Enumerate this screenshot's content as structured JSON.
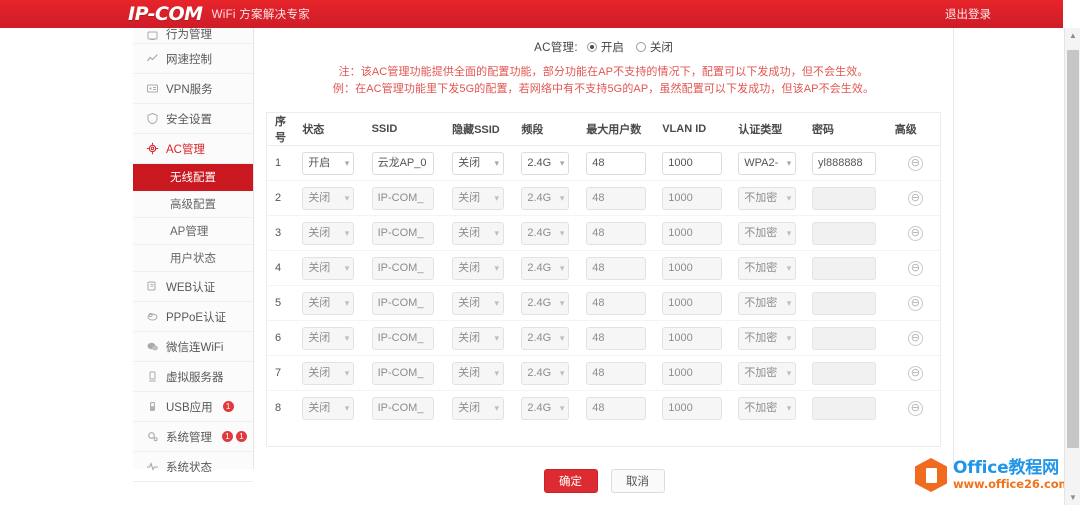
{
  "header": {
    "logo_text": "IP-COM",
    "tagline": "WiFi 方案解决专家",
    "logout": "退出登录",
    "brand_color": "#d8202a"
  },
  "sidebar": {
    "items": [
      {
        "label": "行为管理",
        "icon": "behavior-icon",
        "active": false
      },
      {
        "label": "网速控制",
        "icon": "speed-control-icon",
        "active": false
      },
      {
        "label": "VPN服务",
        "icon": "vpn-icon",
        "active": false
      },
      {
        "label": "安全设置",
        "icon": "shield-icon",
        "active": false
      },
      {
        "label": "AC管理",
        "icon": "gear-icon",
        "active": true
      },
      {
        "label": "WEB认证",
        "icon": "web-auth-icon",
        "active": false
      },
      {
        "label": "PPPoE认证",
        "icon": "pppoe-icon",
        "active": false
      },
      {
        "label": "微信连WiFi",
        "icon": "wechat-wifi-icon",
        "active": false
      },
      {
        "label": "虚拟服务器",
        "icon": "virtual-server-icon",
        "active": false
      },
      {
        "label": "USB应用",
        "icon": "usb-icon",
        "active": false
      },
      {
        "label": "系统管理",
        "icon": "system-gear-icon",
        "active": false,
        "badges": [
          "1",
          "1"
        ]
      },
      {
        "label": "系统状态",
        "icon": "pulse-icon",
        "active": false
      }
    ],
    "sub_items": [
      {
        "label": "无线配置",
        "selected": true
      },
      {
        "label": "高级配置",
        "selected": false
      },
      {
        "label": "AP管理",
        "selected": false
      },
      {
        "label": "用户状态",
        "selected": false
      }
    ]
  },
  "main": {
    "ac_label": "AC管理:",
    "radio_on": "开启",
    "radio_off": "关闭",
    "selected_radio": "开启",
    "note1": "注：该AC管理功能提供全面的配置功能，部分功能在AP不支持的情况下，配置可以下发成功，但不会生效。",
    "note2": "例：在AC管理功能里下发5G的配置，若网络中有不支持5G的AP，虽然配置可以下发成功，但该AP不会生效。",
    "note_color": "#e2554f"
  },
  "table": {
    "headers": [
      "序号",
      "状态",
      "SSID",
      "隐藏SSID",
      "频段",
      "最大用户数",
      "VLAN ID",
      "认证类型",
      "密码",
      "高级"
    ],
    "rows": [
      {
        "no": "1",
        "state": "开启",
        "ssid": "云龙AP_0",
        "hide": "关闭",
        "band": "2.4G",
        "max_users": "48",
        "vlan": "1000",
        "auth": "WPA2-",
        "password": "yl888888",
        "adv": "⊖",
        "enabled": true
      },
      {
        "no": "2",
        "state": "关闭",
        "ssid": "IP-COM_",
        "hide": "关闭",
        "band": "2.4G",
        "max_users": "48",
        "vlan": "1000",
        "auth": "不加密",
        "password": "",
        "adv": "⊖",
        "enabled": false
      },
      {
        "no": "3",
        "state": "关闭",
        "ssid": "IP-COM_",
        "hide": "关闭",
        "band": "2.4G",
        "max_users": "48",
        "vlan": "1000",
        "auth": "不加密",
        "password": "",
        "adv": "⊖",
        "enabled": false
      },
      {
        "no": "4",
        "state": "关闭",
        "ssid": "IP-COM_",
        "hide": "关闭",
        "band": "2.4G",
        "max_users": "48",
        "vlan": "1000",
        "auth": "不加密",
        "password": "",
        "adv": "⊖",
        "enabled": false
      },
      {
        "no": "5",
        "state": "关闭",
        "ssid": "IP-COM_",
        "hide": "关闭",
        "band": "2.4G",
        "max_users": "48",
        "vlan": "1000",
        "auth": "不加密",
        "password": "",
        "adv": "⊖",
        "enabled": false
      },
      {
        "no": "6",
        "state": "关闭",
        "ssid": "IP-COM_",
        "hide": "关闭",
        "band": "2.4G",
        "max_users": "48",
        "vlan": "1000",
        "auth": "不加密",
        "password": "",
        "adv": "⊖",
        "enabled": false
      },
      {
        "no": "7",
        "state": "关闭",
        "ssid": "IP-COM_",
        "hide": "关闭",
        "band": "2.4G",
        "max_users": "48",
        "vlan": "1000",
        "auth": "不加密",
        "password": "",
        "adv": "⊖",
        "enabled": false
      },
      {
        "no": "8",
        "state": "关闭",
        "ssid": "IP-COM_",
        "hide": "关闭",
        "band": "2.4G",
        "max_users": "48",
        "vlan": "1000",
        "auth": "不加密",
        "password": "",
        "adv": "⊖",
        "enabled": false
      }
    ]
  },
  "footer": {
    "confirm": "确定",
    "cancel": "取消"
  },
  "watermark": {
    "title": "Office教程网",
    "url": "www.office26.com",
    "title_color": "#2196e8",
    "url_color": "#f2721c"
  },
  "scrollbar": {
    "up_arrow": "▲",
    "down_arrow": "▼"
  }
}
